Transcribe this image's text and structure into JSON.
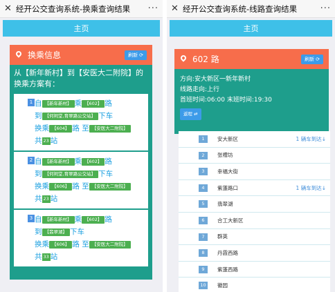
{
  "left": {
    "title": "经开公交查询系统-换乘查询结果",
    "close": "✕",
    "more": "···",
    "home": "主页",
    "section_title": "换乘信息",
    "refresh": "刷新",
    "intro": "从【新年新村】到【安医大二附院】的换乘方案有：",
    "plans": [
      {
        "num": "1",
        "from": "【新年新村】",
        "bus1": "【602】",
        "at": "【何祠堂,育翠路公交站】",
        "bus2": "【604】",
        "to": "【安医大二附院】",
        "count": "23"
      },
      {
        "num": "2",
        "from": "【新年新村】",
        "bus1": "【602】",
        "at": "【何祠堂,育翠路公交站】",
        "bus2": "【606】",
        "to": "【安医大二附院】",
        "count": "23"
      },
      {
        "num": "3",
        "from": "【新年新村】",
        "bus1": "【602】",
        "at": "【翡翠湖】",
        "bus2": "【606】",
        "to": "【安医大二附院】",
        "count": "33"
      }
    ],
    "words": {
      "zi": "自",
      "cheng": "乘",
      "lu": "路",
      "dao": "到",
      "xiache": "下车",
      "huancheng": "换乘",
      "luzhi": "路 至",
      "gong": "共",
      "zhan": "站"
    }
  },
  "right": {
    "title": "经开公交查询系统-线路查询结果",
    "close": "✕",
    "more": "···",
    "home": "主页",
    "route_name": "602 路",
    "refresh": "刷新",
    "direction": "方向:安大新区一新年新村",
    "line_dir": "线路走向:上行",
    "times": "首班时间:06:00 末班时间:19:30",
    "return_btn": "返程",
    "stops": [
      {
        "idx": "1",
        "name": "安大新区",
        "status": "1 辆车到达"
      },
      {
        "idx": "2",
        "name": "张槽坊",
        "status": ""
      },
      {
        "idx": "3",
        "name": "幸福大街",
        "status": ""
      },
      {
        "idx": "4",
        "name": "紫蓬路口",
        "status": "1 辆车到达"
      },
      {
        "idx": "5",
        "name": "翡翠湖",
        "status": ""
      },
      {
        "idx": "6",
        "name": "合工大新区",
        "status": ""
      },
      {
        "idx": "7",
        "name": "群英",
        "status": ""
      },
      {
        "idx": "8",
        "name": "丹霞西路",
        "status": ""
      },
      {
        "idx": "9",
        "name": "紫蓬西路",
        "status": ""
      },
      {
        "idx": "10",
        "name": "徽园",
        "status": ""
      }
    ]
  },
  "colors": {
    "header": "#f76d4b",
    "card": "#1e9e8c",
    "home": "#3ec0e8",
    "tag": "#4caf50",
    "link": "#1a9fe0"
  }
}
